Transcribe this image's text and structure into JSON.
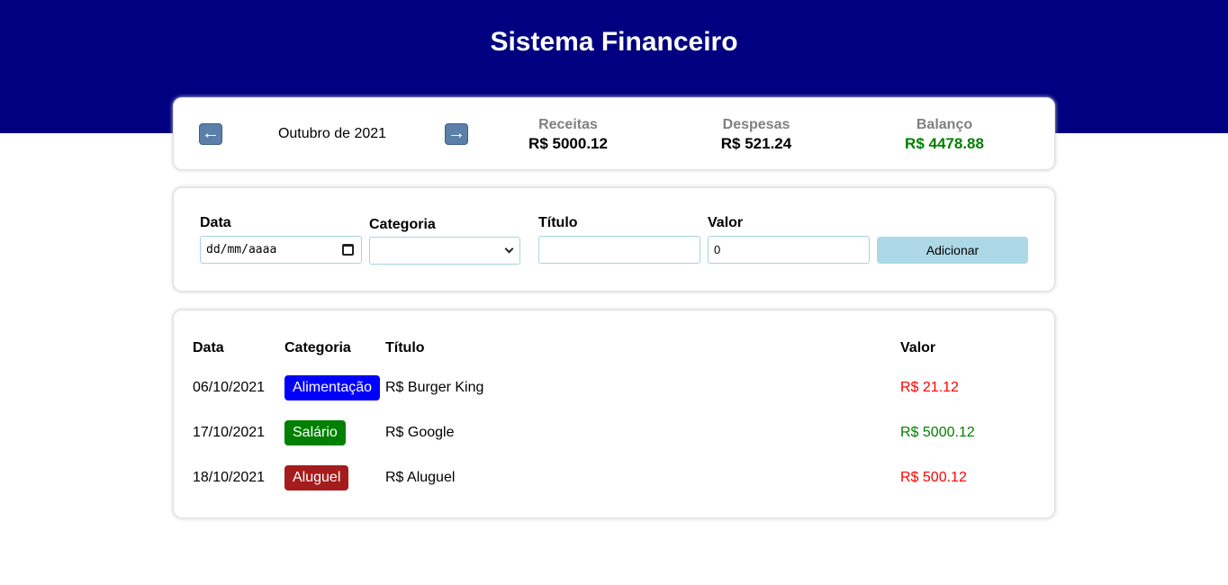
{
  "app": {
    "title": "Sistema Financeiro"
  },
  "info": {
    "prev_icon": "arrow-left-icon",
    "next_icon": "arrow-right-icon",
    "month_label": "Outubro de 2021",
    "receitas": {
      "label": "Receitas",
      "value": "R$ 5000.12"
    },
    "despesas": {
      "label": "Despesas",
      "value": "R$ 521.24"
    },
    "balanco": {
      "label": "Balanço",
      "value": "R$ 4478.88",
      "color": "#008000"
    }
  },
  "form": {
    "data_label": "Data",
    "data_placeholder": "dd/mm/aaaa",
    "categoria_label": "Categoria",
    "categoria_value": "",
    "titulo_label": "Título",
    "titulo_value": "",
    "valor_label": "Valor",
    "valor_value": "0",
    "add_label": "Adicionar"
  },
  "table": {
    "headers": {
      "data": "Data",
      "categoria": "Categoria",
      "titulo": "Título",
      "valor": "Valor"
    },
    "rows": [
      {
        "data": "06/10/2021",
        "categoria": "Alimentação",
        "categoria_color": "#0000ff",
        "titulo": "R$ Burger King",
        "valor": "R$ 21.12",
        "valor_color": "#ff0000"
      },
      {
        "data": "17/10/2021",
        "categoria": "Salário",
        "categoria_color": "#008000",
        "titulo": "R$ Google",
        "valor": "R$ 5000.12",
        "valor_color": "#008000"
      },
      {
        "data": "18/10/2021",
        "categoria": "Aluguel",
        "categoria_color": "#a51c1c",
        "titulo": "R$ Aluguel",
        "valor": "R$ 500.12",
        "valor_color": "#ff0000"
      }
    ]
  },
  "colors": {
    "header_bg": "#000080",
    "add_button_bg": "#add8e6"
  }
}
